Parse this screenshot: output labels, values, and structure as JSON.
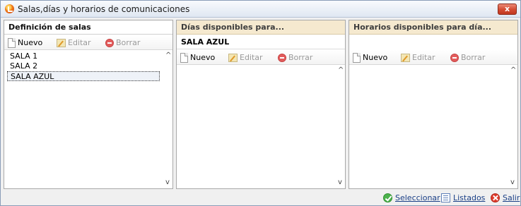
{
  "window": {
    "title": "Salas,días y horarios de comunicaciones",
    "close_label": "x"
  },
  "panels": {
    "salas": {
      "header": "Definición de salas",
      "toolbar": {
        "new": "Nuevo",
        "edit": "Editar",
        "delete": "Borrar"
      },
      "items": [
        "SALA 1",
        "SALA 2",
        "SALA AZUL"
      ],
      "selected_index": 2
    },
    "dias": {
      "header": "Días disponibles para...",
      "subheader": "SALA AZUL",
      "toolbar": {
        "new": "Nuevo",
        "edit": "Editar",
        "delete": "Borrar"
      },
      "items": []
    },
    "horarios": {
      "header": "Horarios disponibles para día...",
      "toolbar": {
        "new": "Nuevo",
        "edit": "Editar",
        "delete": "Borrar"
      },
      "items": []
    }
  },
  "footer": {
    "select": "Seleccionar",
    "lists": "Listados",
    "exit": "Salir"
  },
  "colors": {
    "tan_header": "#f5e9cf",
    "link": "#1a3f86",
    "close": "#d34a31"
  }
}
